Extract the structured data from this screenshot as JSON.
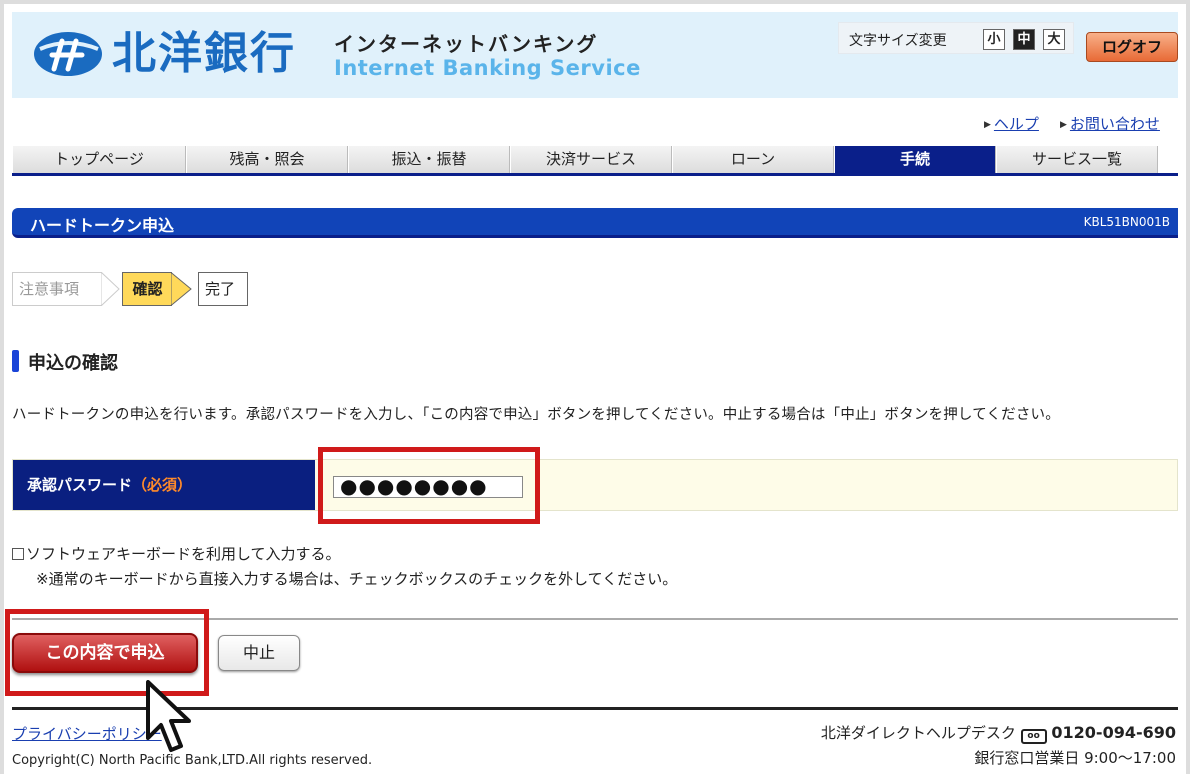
{
  "header": {
    "bank_name": "北洋銀行",
    "service_jp": "インターネットバンキング",
    "service_en": "Internet Banking Service",
    "font_size_label": "文字サイズ変更",
    "font_sizes": [
      "小",
      "中",
      "大"
    ],
    "font_size_selected": "中",
    "logoff_label": "ログオフ"
  },
  "util_links": {
    "help": "ヘルプ",
    "contact": "お問い合わせ"
  },
  "nav": {
    "items": [
      "トップページ",
      "残高・照会",
      "振込・振替",
      "決済サービス",
      "ローン",
      "手続",
      "サービス一覧"
    ],
    "active": "手続"
  },
  "page": {
    "title": "ハードトークン申込",
    "screen_code": "KBL51BN001B"
  },
  "steps": {
    "items": [
      "注意事項",
      "確認",
      "完了"
    ],
    "current": "確認"
  },
  "section": {
    "title": "申込の確認",
    "description": "ハードトークンの申込を行います。承認パスワードを入力し、「この内容で申込」ボタンを押してください。中止する場合は「中止」ボタンを押してください。"
  },
  "form": {
    "password_label": "承認パスワード",
    "required_label": "（必須）",
    "password_value": "●●●●●●●●",
    "software_keyboard_label": "ソフトウェアキーボードを利用して入力する。",
    "software_keyboard_checked": false,
    "software_keyboard_note": "※通常のキーボードから直接入力する場合は、チェックボックスのチェックを外してください。"
  },
  "buttons": {
    "apply": "この内容で申込",
    "cancel": "中止"
  },
  "footer": {
    "privacy": "プライバシーポリシー",
    "copyright": "Copyright(C) North Pacific Bank,LTD.All rights reserved.",
    "helpdesk_label": "北洋ダイレクトヘルプデスク",
    "freedial_icon": "free-dial-icon",
    "phone": "0120-094-690",
    "hours": "銀行窓口営業日 9:00〜17:00"
  },
  "colors": {
    "brand_blue": "#1a6bc0",
    "nav_active": "#0a1f8a",
    "highlight_red": "#d01a1a",
    "apply_button": "#b01010"
  }
}
